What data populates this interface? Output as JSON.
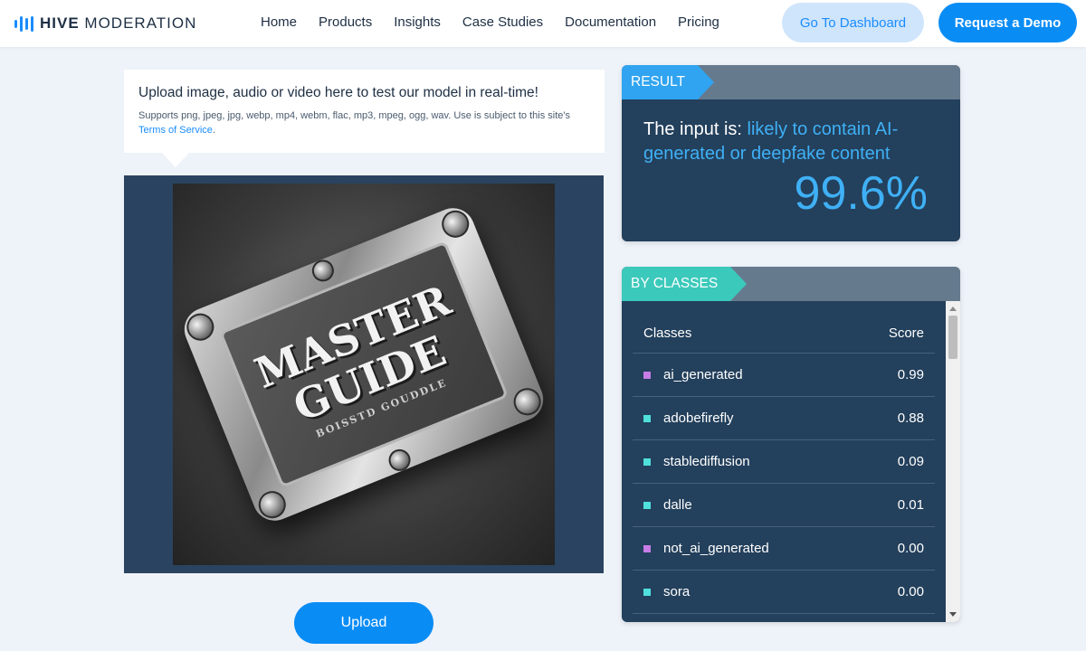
{
  "brand": {
    "name_bold": "HIVE",
    "name_rest": " MODERATION"
  },
  "nav": {
    "links": [
      "Home",
      "Products",
      "Insights",
      "Case Studies",
      "Documentation",
      "Pricing"
    ],
    "dashboard_label": "Go To Dashboard",
    "demo_label": "Request a Demo"
  },
  "upload": {
    "title": "Upload image, audio or video here to test our model in real-time!",
    "subtitle_prefix": "Supports png, jpeg, jpg, webp, mp4, webm, flac, mp3, mpeg, ogg, wav. Use is subject to this site's ",
    "terms_link": "Terms of Service",
    "subtitle_suffix": ".",
    "button_label": "Upload",
    "preview_text": {
      "line1": "MASTER",
      "line2": "GUIDE",
      "small": "BOISSTD GOUDDLE"
    }
  },
  "result": {
    "tag": "RESULT",
    "prefix": "The input is: ",
    "verdict": "likely to contain AI-generated or deepfake content",
    "percentage": "99.6%"
  },
  "by_classes": {
    "tag": "BY CLASSES",
    "header_class": "Classes",
    "header_score": "Score",
    "rows": [
      {
        "name": "ai_generated",
        "score": "0.99",
        "color": "#c77ce6"
      },
      {
        "name": "adobefirefly",
        "score": "0.88",
        "color": "#4fe0dc"
      },
      {
        "name": "stablediffusion",
        "score": "0.09",
        "color": "#4fe0dc"
      },
      {
        "name": "dalle",
        "score": "0.01",
        "color": "#4fe0dc"
      },
      {
        "name": "not_ai_generated",
        "score": "0.00",
        "color": "#c77ce6"
      },
      {
        "name": "sora",
        "score": "0.00",
        "color": "#4fe0dc"
      }
    ]
  },
  "colors": {
    "accent": "#0a8cf5",
    "result_highlight": "#3fb0f5",
    "panel_dark": "#23405c",
    "tag_teal": "#3bc9bb"
  }
}
